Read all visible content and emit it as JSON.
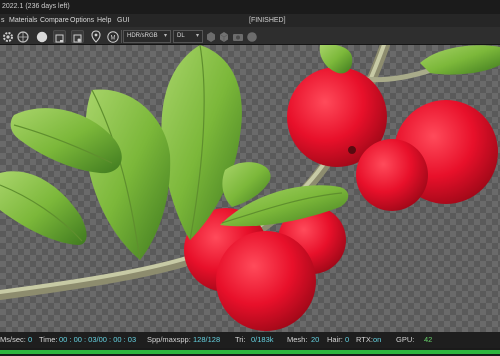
{
  "window": {
    "title": "2022.1 (236 days left)"
  },
  "menu": {
    "items": [
      "s",
      "Materials",
      "Compare",
      "Options",
      "Help",
      "GUI"
    ],
    "render_status": "[FINISHED]"
  },
  "toolbar": {
    "icons": [
      "gear-icon",
      "sphere-icon",
      "sphere-solid-icon",
      "save-image-icon",
      "export-icon",
      "pin-icon",
      "m-badge-icon"
    ],
    "color_space": "HDR/sRGB",
    "kernel": "DL",
    "right_icons": [
      "shape-hex-icon",
      "shape-cube-icon",
      "camera-icon",
      "circle-icon"
    ]
  },
  "status": {
    "ms_label": "Ms/sec:",
    "ms_value": "0",
    "time_label": "Time:",
    "time_value": "00 : 00 : 03/00 : 00 : 03",
    "spp_label": "Spp/maxspp:",
    "spp_value": "128/128",
    "tri_label": "Tri:",
    "tri_value": "0/183k",
    "mesh_label": "Mesh:",
    "mesh_value": "20",
    "hair_label": "Hair:",
    "hair_value": "0",
    "rtx_label": "RTX:",
    "rtx_value": "on",
    "gpu_label": "GPU:",
    "gpu_value": "42"
  },
  "render_progress": 1.0,
  "colors": {
    "accent_green": "#2fb53f",
    "value_cyan": "#65d1e0",
    "berry_red": "#e8102a",
    "leaf_green": "#7cb83a"
  }
}
